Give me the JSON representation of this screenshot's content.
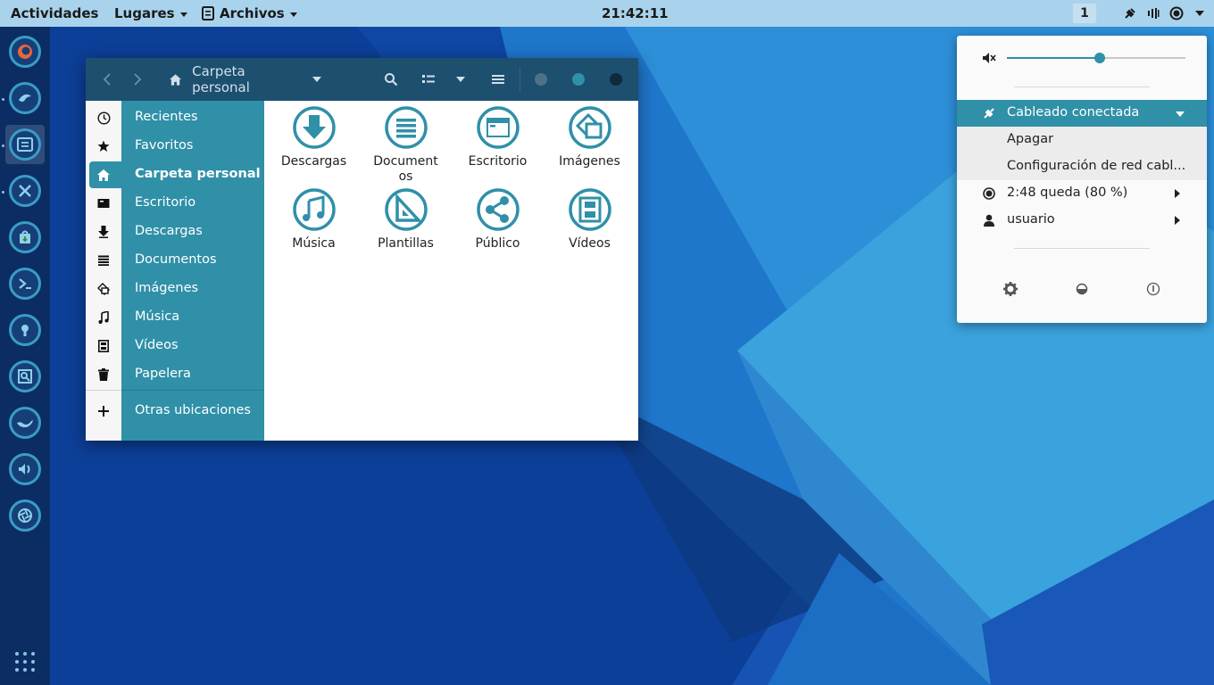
{
  "topbar": {
    "activities": "Actividades",
    "places": "Lugares",
    "app_menu": "Archivos",
    "clock": "21:42:11",
    "workspace": "1",
    "icons": [
      "network-wired-icon",
      "volume-icon",
      "battery-icon",
      "system-menu-arrow-icon"
    ]
  },
  "dock": {
    "items": [
      {
        "name": "firefox-icon"
      },
      {
        "name": "thunderbird-icon"
      },
      {
        "name": "files-icon",
        "active": true
      },
      {
        "name": "tools-icon"
      },
      {
        "name": "software-center-icon"
      },
      {
        "name": "terminal-icon"
      },
      {
        "name": "keyring-icon"
      },
      {
        "name": "screenshot-icon"
      },
      {
        "name": "genie-lamp-icon"
      },
      {
        "name": "sound-icon"
      },
      {
        "name": "camera-aperture-icon"
      }
    ],
    "show_apps": "show-apps-grid-icon"
  },
  "files": {
    "path_label": "Carpeta personal",
    "sidebar": [
      {
        "label": "Recientes",
        "icon": "clock-icon"
      },
      {
        "label": "Favoritos",
        "icon": "star-icon"
      },
      {
        "label": "Carpeta personal",
        "icon": "home-icon",
        "selected": true
      },
      {
        "label": "Escritorio",
        "icon": "desktop-icon"
      },
      {
        "label": "Descargas",
        "icon": "download-icon"
      },
      {
        "label": "Documentos",
        "icon": "document-icon"
      },
      {
        "label": "Imágenes",
        "icon": "image-icon"
      },
      {
        "label": "Música",
        "icon": "music-icon"
      },
      {
        "label": "Vídeos",
        "icon": "video-icon"
      },
      {
        "label": "Papelera",
        "icon": "trash-icon"
      },
      {
        "label": "Otras ubicaciones",
        "icon": "plus-icon"
      }
    ],
    "folders": [
      {
        "label": "Descargas",
        "icon": "folder-download-icon"
      },
      {
        "label": "Documentos",
        "icon": "folder-documents-icon"
      },
      {
        "label": "Escritorio",
        "icon": "folder-desktop-icon"
      },
      {
        "label": "Imágenes",
        "icon": "folder-pictures-icon"
      },
      {
        "label": "Música",
        "icon": "folder-music-icon"
      },
      {
        "label": "Plantillas",
        "icon": "folder-templates-icon"
      },
      {
        "label": "Público",
        "icon": "folder-public-icon"
      },
      {
        "label": "Vídeos",
        "icon": "folder-videos-icon"
      }
    ]
  },
  "system_menu": {
    "volume_level": 0.52,
    "wired": "Cableado conectada",
    "wired_submenu": [
      "Apagar",
      "Configuración de red cabl..."
    ],
    "battery": "2:48 queda (80 %)",
    "user": "usuario",
    "bottom_buttons": [
      "settings-icon",
      "lock-icon",
      "power-icon"
    ]
  },
  "colors": {
    "accent": "#2f90a8",
    "topbar": "#a9d3ec",
    "dock": "#0b2d63",
    "headerbar": "#1d4f6f"
  }
}
